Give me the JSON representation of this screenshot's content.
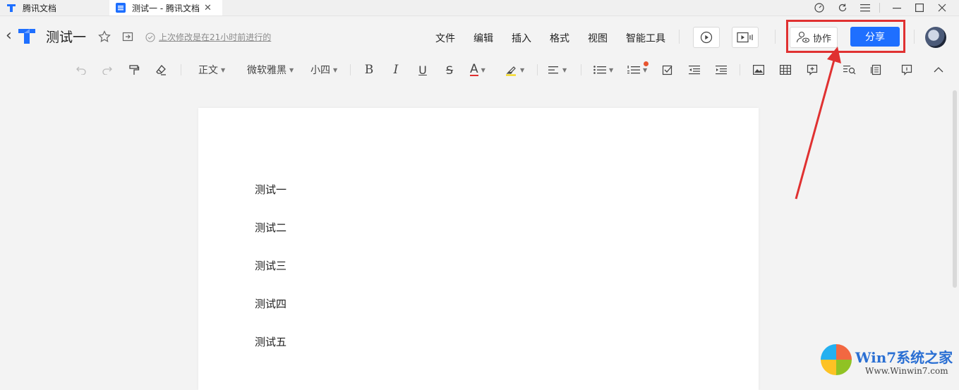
{
  "app": {
    "inactive_tab_title": "腾讯文档",
    "active_tab_title": "测试一 - 腾讯文档",
    "tab_close_glyph": "✕"
  },
  "window_controls": [
    "speed-icon",
    "refresh-icon",
    "menu-icon",
    "minimize-icon",
    "maximize-icon",
    "close-icon"
  ],
  "header": {
    "back_glyph": "‹",
    "doc_title": "测试一",
    "saved_status": "上次修改是在21小时前进行的",
    "menu": [
      "文件",
      "编辑",
      "插入",
      "格式",
      "视图",
      "智能工具"
    ],
    "collab_label": "协作",
    "share_label": "分享"
  },
  "toolbar": {
    "paragraph_style": "正文",
    "font_family": "微软雅黑",
    "font_size": "小四",
    "bold": "B",
    "italic": "I",
    "underline": "U",
    "strike": "S",
    "font_color_letter": "A"
  },
  "document": {
    "lines": [
      "测试一",
      "测试二",
      "测试三",
      "测试四",
      "测试五"
    ]
  },
  "watermark": {
    "brand": "Win7系统之家",
    "url": "Www.Winwin7.com"
  },
  "colors": {
    "accent": "#1e6fff",
    "annotation_red": "#e03131",
    "font_color_underline": "#e03131",
    "highlight_underline": "#f5d400",
    "notification_dot": "#e8542f"
  }
}
